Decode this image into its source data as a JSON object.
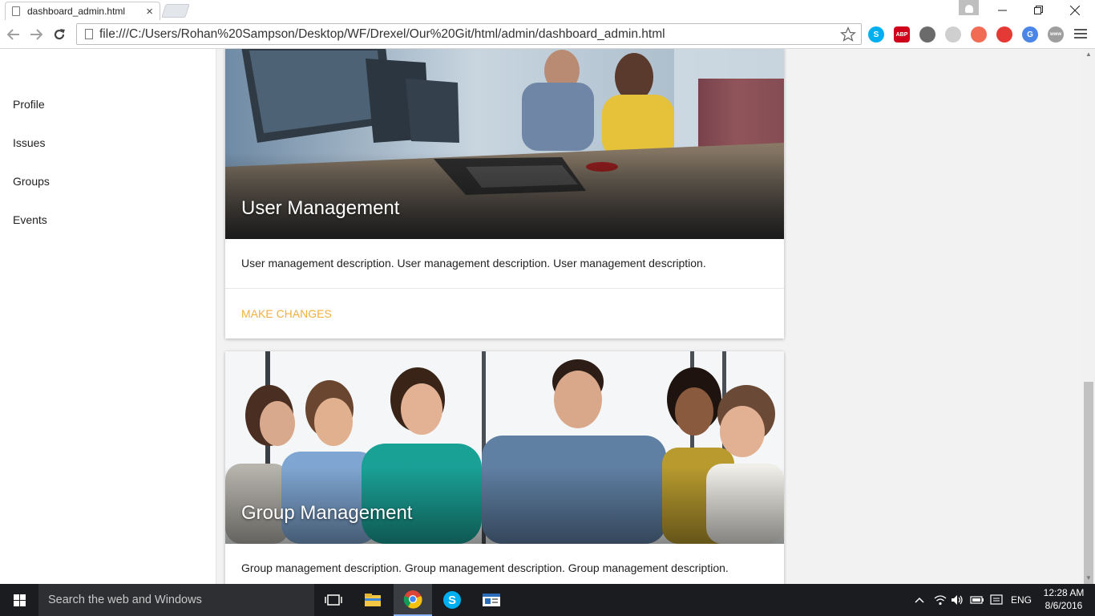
{
  "browser": {
    "tab_title": "dashboard_admin.html",
    "tab_close": "×",
    "url": "file:///C:/Users/Rohan%20Sampson/Desktop/WF/Drexel/Our%20Git/html/admin/dashboard_admin.html",
    "extensions": [
      {
        "name": "skype-icon",
        "label": "S",
        "color": "#00aff0"
      },
      {
        "name": "adblock-plus-icon",
        "label": "ABP",
        "color": "#d0021b"
      },
      {
        "name": "bulb-icon",
        "label": "",
        "color": "#6b6b6b"
      },
      {
        "name": "refresh-ext-icon",
        "label": "",
        "color": "#cfcfcf"
      },
      {
        "name": "blocked-ext-icon",
        "label": "",
        "color": "#f26b55"
      },
      {
        "name": "target-ext-icon",
        "label": "",
        "color": "#e53935"
      },
      {
        "name": "google-translate-icon",
        "label": "G",
        "color": "#4a86e8"
      },
      {
        "name": "www-ext-icon",
        "label": "www",
        "color": "#9e9e9e"
      }
    ]
  },
  "sidebar": {
    "items": [
      {
        "label": "Profile"
      },
      {
        "label": "Issues"
      },
      {
        "label": "Groups"
      },
      {
        "label": "Events"
      }
    ]
  },
  "cards": [
    {
      "title": "User Management",
      "description": "User management description. User management description. User management description.",
      "action": "MAKE CHANGES"
    },
    {
      "title": "Group Management",
      "description": "Group management description. Group management description. Group management description."
    }
  ],
  "colors": {
    "accent": "#f0b041",
    "page_background": "#f2f2f2",
    "taskbar": "#1a1c1f"
  },
  "taskbar": {
    "search_placeholder": "Search the web and Windows",
    "language": "ENG",
    "time": "12:28 AM",
    "date": "8/6/2016"
  }
}
